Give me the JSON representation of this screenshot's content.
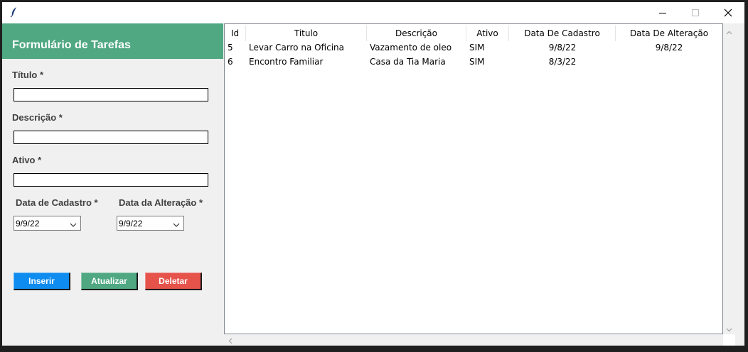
{
  "window": {
    "controls": [
      "minimize-icon",
      "maximize-icon",
      "close-icon"
    ],
    "icon": "feather-icon"
  },
  "form": {
    "title": "Formulário de Tarefas",
    "header_color": "#4fa882",
    "fields": {
      "titulo_label": "Título *",
      "titulo_value": "",
      "descricao_label": "Descrição *",
      "descricao_value": "",
      "ativo_label": "Ativo *",
      "ativo_value": "",
      "cadastro_label": "Data de Cadastro *",
      "cadastro_value": "9/9/22",
      "alteracao_label": "Data da Alteração *",
      "alteracao_value": "9/9/22"
    },
    "buttons": {
      "inserir": "Inserir",
      "atualizar": "Atualizar",
      "deletar": "Deletar"
    },
    "colors": {
      "inserir": "#0e8cf0",
      "atualizar": "#4fa882",
      "deletar": "#e5534b"
    }
  },
  "table": {
    "columns": [
      "Id",
      "Titulo",
      "Descrição",
      "Ativo",
      "Data De Cadastro",
      "Data De Alteração"
    ],
    "rows": [
      [
        "5",
        "Levar Carro na Oficina",
        "Vazamento de oleo",
        "SIM",
        "9/8/22",
        "9/8/22"
      ],
      [
        "6",
        "Encontro Familiar",
        "Casa da Tia Maria",
        "SIM",
        "8/3/22",
        ""
      ]
    ]
  }
}
